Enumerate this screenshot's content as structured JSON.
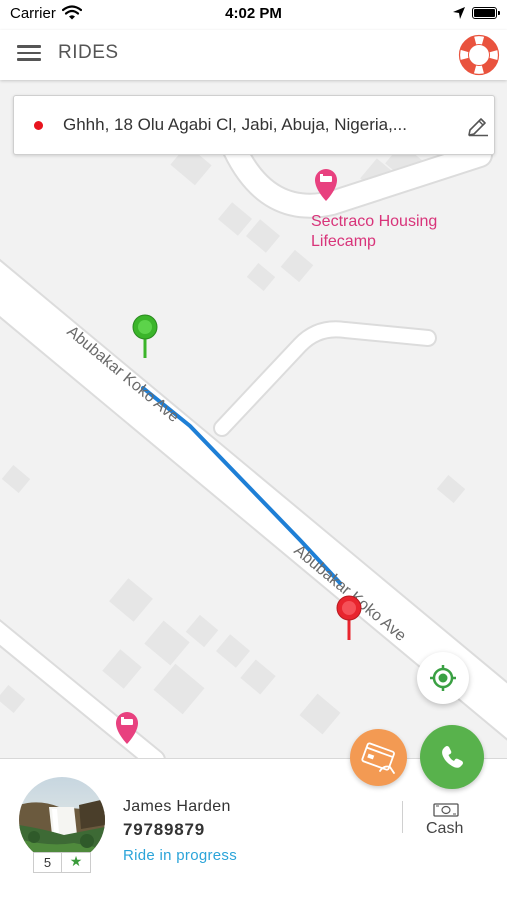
{
  "status_bar": {
    "carrier": "Carrier",
    "time": "4:02 PM"
  },
  "header": {
    "title": "RIDES",
    "menu_icon": "hamburger-menu-icon",
    "help_icon": "lifebuoy-icon"
  },
  "pickup": {
    "address": "Ghhh, 18 Olu Agabi Cl, Jabi, Abuja, Nigeria,...",
    "edit_icon": "pencil-icon",
    "dot_color": "#e8141e"
  },
  "map": {
    "poi_name_line1": "Sectraco Housing",
    "poi_name_line2": "Lifecamp",
    "street_name_1": "Abubakar Koko Ave",
    "street_name_2": "Abubakar Koko Ave",
    "route_color": "#1e7fd6",
    "pickup_marker_color": "#3bb52a",
    "dropoff_marker_color": "#e8252e",
    "poi_color": "#e8417f"
  },
  "driver": {
    "name": "James Harden",
    "phone": "79789879",
    "status": "Ride in progress",
    "rating": "5",
    "rating_icon": "star-icon"
  },
  "payment": {
    "method": "Cash",
    "icon": "cash-icon"
  },
  "actions": {
    "locate_icon": "my-location-icon",
    "card_icon": "credit-card-icon",
    "call_icon": "phone-icon",
    "call_color": "#58b24c",
    "card_color": "#f39a53"
  }
}
